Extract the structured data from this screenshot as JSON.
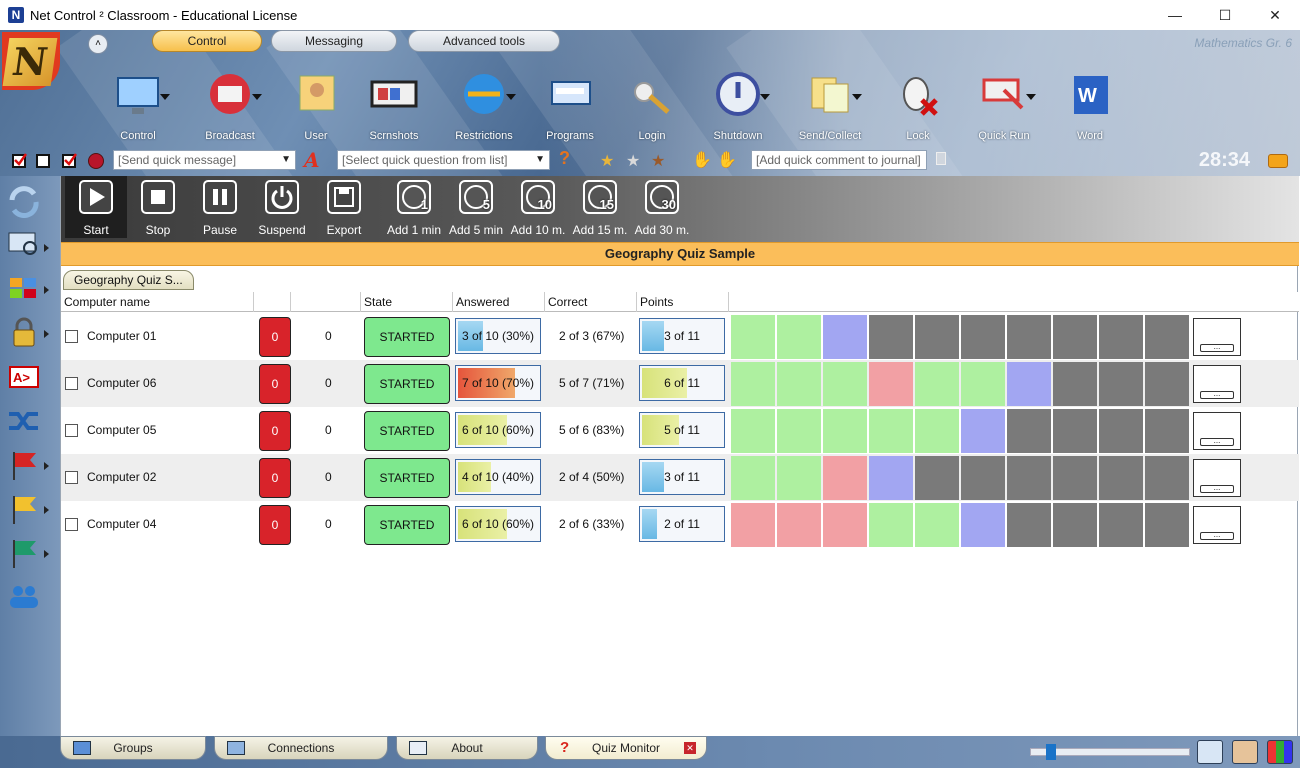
{
  "window": {
    "title": "Net Control ² Classroom - Educational License",
    "minimize": "—",
    "maximize": "☐",
    "close": "✕"
  },
  "ribbon": {
    "tabs": [
      {
        "label": "Control",
        "active": true
      },
      {
        "label": "Messaging",
        "active": false
      },
      {
        "label": "Advanced tools",
        "active": false
      }
    ],
    "class_name": "Mathematics Gr. 6",
    "tools": [
      {
        "label": "Control",
        "icon": "monitor-icon"
      },
      {
        "label": "Broadcast",
        "icon": "broadcast-icon"
      },
      {
        "label": "User",
        "icon": "user-icon"
      },
      {
        "label": "Scrnshots",
        "icon": "screenshots-icon"
      },
      {
        "label": "Restrictions",
        "icon": "restrictions-icon"
      },
      {
        "label": "Programs",
        "icon": "programs-icon"
      },
      {
        "label": "Login",
        "icon": "login-keys-icon"
      },
      {
        "label": "Shutdown",
        "icon": "shutdown-icon"
      },
      {
        "label": "Send/Collect",
        "icon": "send-collect-icon"
      },
      {
        "label": "Lock",
        "icon": "lock-mouse-icon"
      },
      {
        "label": "Quick Run",
        "icon": "quick-run-icon"
      },
      {
        "label": "Word",
        "icon": "word-icon"
      }
    ]
  },
  "quickbar": {
    "message_placeholder": "[Send quick message]",
    "question_placeholder": "[Select quick question from list]",
    "journal_placeholder": "[Add quick comment to journal]",
    "timer": "28:34",
    "font_glyph": "A",
    "help_glyph": "?"
  },
  "quiz_toolbar": {
    "buttons": [
      {
        "label": "Start",
        "icon": "play-icon"
      },
      {
        "label": "Stop",
        "icon": "stop-icon"
      },
      {
        "label": "Pause",
        "icon": "pause-icon"
      },
      {
        "label": "Suspend",
        "icon": "power-icon"
      },
      {
        "label": "Export",
        "icon": "save-icon"
      }
    ],
    "timers": [
      {
        "label": "Add 1 min",
        "num": "1"
      },
      {
        "label": "Add 5 min",
        "num": "5"
      },
      {
        "label": "Add 10 m.",
        "num": "10"
      },
      {
        "label": "Add 15 m.",
        "num": "15"
      },
      {
        "label": "Add 30 m.",
        "num": "30"
      }
    ]
  },
  "quiz": {
    "title": "Geography Quiz Sample",
    "tab": "Geography Quiz S...",
    "columns": [
      "Computer name",
      "",
      "",
      "State",
      "Answered",
      "Correct",
      "Points"
    ],
    "colors": {
      "correct": "#aef0a0",
      "wrong": "#f2a0a4",
      "current": "#a2a6f2",
      "pending": "#7a7a7a"
    },
    "rows": [
      {
        "name": "Computer 01",
        "red": "0",
        "count": "0",
        "state": "STARTED",
        "answered": "3 of 10 (30%)",
        "answered_frac": 0.3,
        "correct": "2 of 3 (67%)",
        "points": "3 of 11",
        "points_frac": 0.27,
        "cells": [
          "correct",
          "correct",
          "current",
          "pending",
          "pending",
          "pending",
          "pending",
          "pending",
          "pending",
          "pending"
        ]
      },
      {
        "name": "Computer 06",
        "red": "0",
        "count": "0",
        "state": "STARTED",
        "answered": "7 of 10 (70%)",
        "answered_frac": 0.7,
        "correct": "5 of 7 (71%)",
        "points": "6 of 11",
        "points_frac": 0.55,
        "cells": [
          "correct",
          "correct",
          "correct",
          "wrong",
          "correct",
          "correct",
          "current",
          "pending",
          "pending",
          "pending"
        ]
      },
      {
        "name": "Computer 05",
        "red": "0",
        "count": "0",
        "state": "STARTED",
        "answered": "6 of 10 (60%)",
        "answered_frac": 0.6,
        "correct": "5 of 6 (83%)",
        "points": "5 of 11",
        "points_frac": 0.45,
        "cells": [
          "correct",
          "correct",
          "correct",
          "correct",
          "correct",
          "current",
          "pending",
          "pending",
          "pending",
          "pending"
        ]
      },
      {
        "name": "Computer 02",
        "red": "0",
        "count": "0",
        "state": "STARTED",
        "answered": "4 of 10 (40%)",
        "answered_frac": 0.4,
        "correct": "2 of 4 (50%)",
        "points": "3 of 11",
        "points_frac": 0.27,
        "cells": [
          "correct",
          "correct",
          "wrong",
          "current",
          "pending",
          "pending",
          "pending",
          "pending",
          "pending",
          "pending"
        ]
      },
      {
        "name": "Computer 04",
        "red": "0",
        "count": "0",
        "state": "STARTED",
        "answered": "6 of 10 (60%)",
        "answered_frac": 0.6,
        "correct": "2 of 6 (33%)",
        "points": "2 of 11",
        "points_frac": 0.18,
        "cells": [
          "wrong",
          "wrong",
          "wrong",
          "correct",
          "correct",
          "current",
          "pending",
          "pending",
          "pending",
          "pending"
        ]
      }
    ],
    "more_label": "..."
  },
  "bottom_tabs": [
    {
      "label": "Groups"
    },
    {
      "label": "Connections"
    },
    {
      "label": "About"
    },
    {
      "label": "Quiz Monitor"
    }
  ],
  "zoom_level": 0.1
}
